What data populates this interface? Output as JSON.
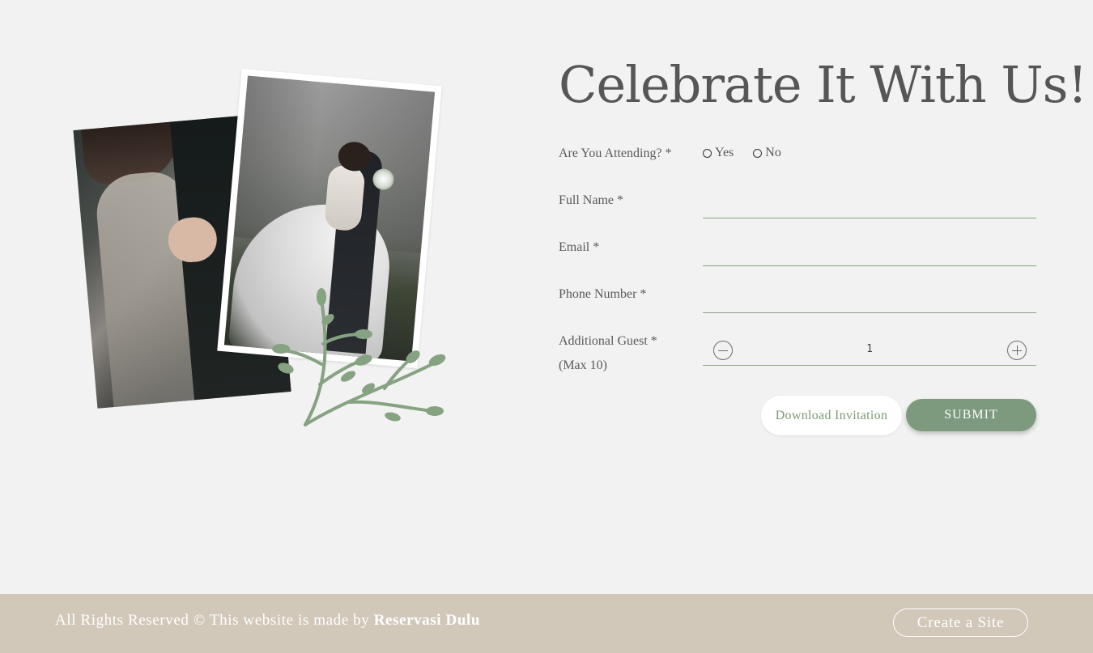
{
  "title": "Celebrate It With Us!",
  "form": {
    "attending_label": "Are You Attending? *",
    "attending_options": [
      "Yes",
      "No"
    ],
    "full_name_label": "Full Name *",
    "full_name_value": "",
    "email_label": "Email *",
    "email_value": "",
    "phone_label": "Phone Number *",
    "phone_value": "",
    "guest_label": "Additional Guest *",
    "guest_max": "(Max 10)",
    "guest_value": "1"
  },
  "buttons": {
    "download": "Download Invitation",
    "submit": "SUBMIT"
  },
  "footer": {
    "text": "All Rights Reserved © This website is made by",
    "brand": "Reservasi Dulu",
    "create_site": "Create a Site"
  },
  "colors": {
    "background": "#f1f2f1",
    "accent": "#7d9a7e",
    "footer": "#d2c8ba"
  }
}
